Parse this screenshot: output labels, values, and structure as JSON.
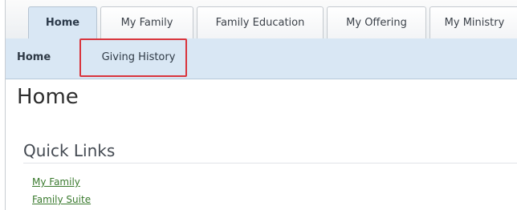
{
  "top_tabs": [
    {
      "label": "Home",
      "active": true
    },
    {
      "label": "My Family",
      "active": false
    },
    {
      "label": "Family Education",
      "active": false
    },
    {
      "label": "My Offering",
      "active": false
    },
    {
      "label": "My Ministry",
      "active": false
    }
  ],
  "subnav": {
    "home_label": "Home",
    "giving_history_label": "Giving History"
  },
  "main": {
    "page_title": "Home",
    "quick_links_title": "Quick Links",
    "links": [
      "My Family",
      "Family Suite"
    ]
  },
  "colors": {
    "active_tab_bg": "#d9e7f4",
    "highlight_border": "#d9343c",
    "link": "#3a7a2e"
  }
}
